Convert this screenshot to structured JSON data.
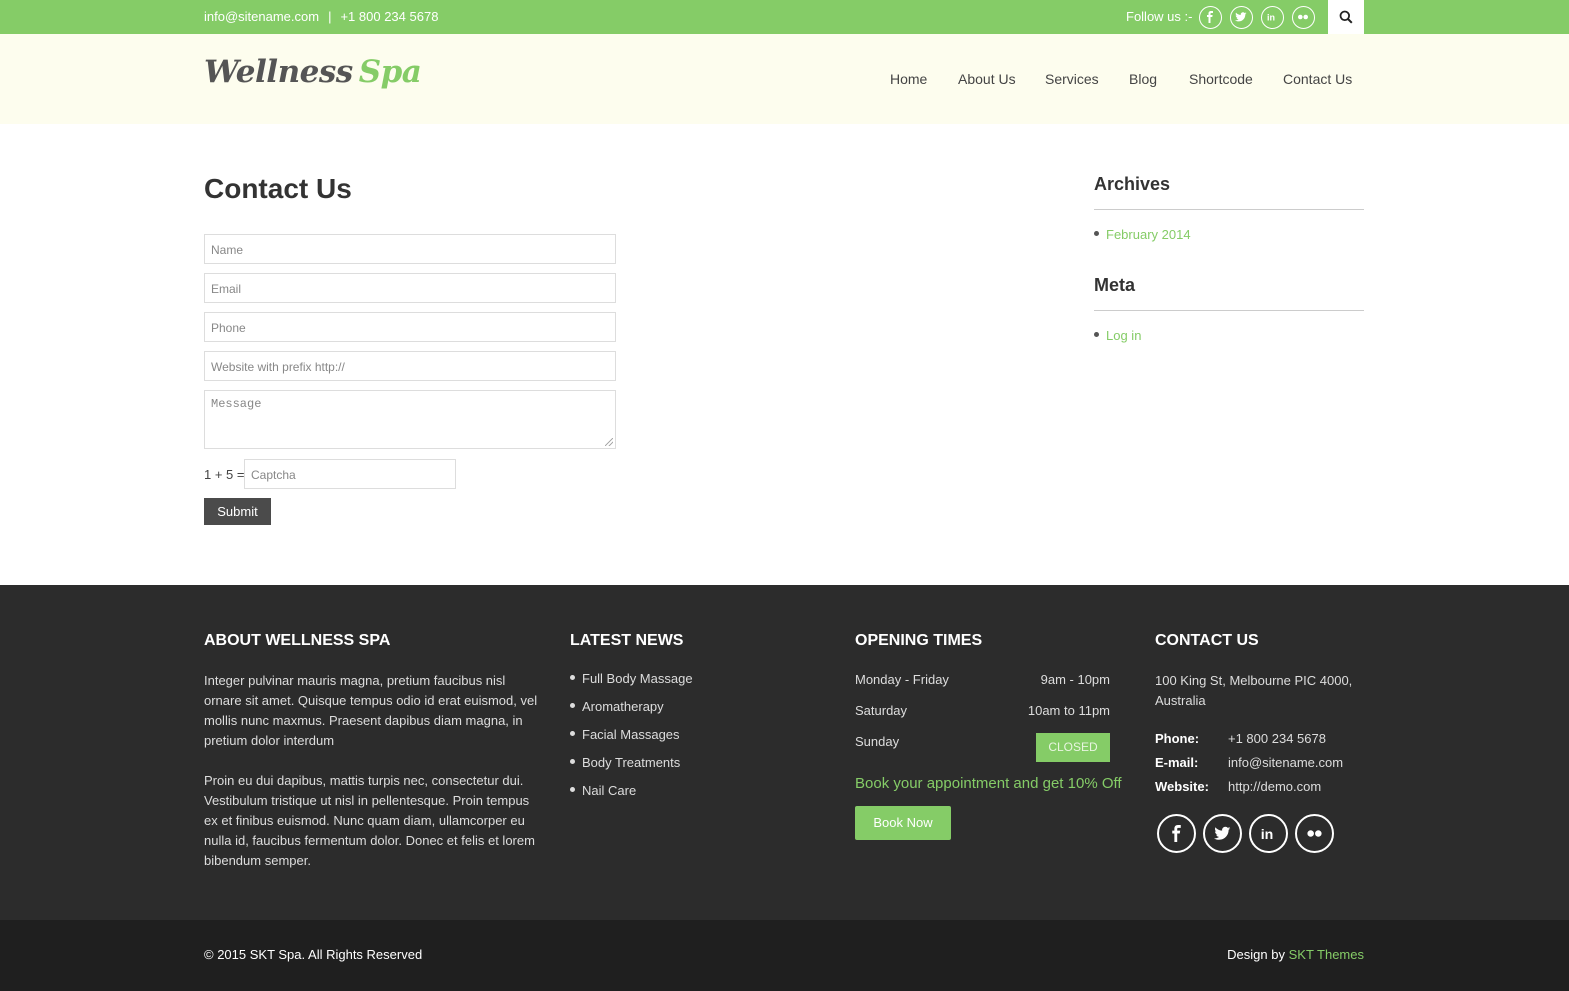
{
  "colors": {
    "accent": "#85cc67",
    "header_bg": "#fdfdee",
    "footer_bg": "#2c2c2c",
    "bottom_bg": "#1f1f1f"
  },
  "topbar": {
    "email": "info@sitename.com",
    "separator": "|",
    "phone": "+1 800 234 5678",
    "follow_label": "Follow us :-",
    "social_icons": [
      "facebook-icon",
      "twitter-icon",
      "linkedin-icon",
      "flickr-icon"
    ],
    "search_icon": "search-icon"
  },
  "header": {
    "logo_word1": "Wellness",
    "logo_word2": "Spa",
    "nav": [
      "Home",
      "About Us",
      "Services",
      "Blog",
      "Shortcode",
      "Contact Us"
    ]
  },
  "main": {
    "title": "Contact Us",
    "form": {
      "name_placeholder": "Name",
      "email_placeholder": "Email",
      "phone_placeholder": "Phone",
      "website_placeholder": "Website with prefix http://",
      "message_placeholder": "Message",
      "captcha_question": "1 + 5 =",
      "captcha_placeholder": "Captcha",
      "submit_label": "Submit"
    }
  },
  "sidebar": {
    "archives_title": "Archives",
    "archives": [
      "February 2014"
    ],
    "meta_title": "Meta",
    "meta": [
      "Log in"
    ]
  },
  "footer": {
    "about": {
      "title": "ABOUT WELLNESS SPA",
      "para1": "Integer pulvinar mauris magna, pretium faucibus nisl ornare sit amet. Quisque tempus odio id erat euismod, vel mollis nunc maxmus. Praesent dapibus diam magna, in pretium dolor interdum",
      "para2": "Proin eu dui dapibus, mattis turpis nec, consectetur dui. Vestibulum tristique ut nisl in pellentesque. Proin tempus ex et finibus euismod. Nunc quam diam, ullamcorper eu nulla id, faucibus fermentum dolor. Donec et felis et lorem bibendum semper."
    },
    "news": {
      "title": "LATEST NEWS",
      "items": [
        "Full Body Massage",
        "Aromatherapy",
        "Facial Massages",
        "Body Treatments",
        "Nail Care"
      ]
    },
    "opening": {
      "title": "OPENING TIMES",
      "rows": [
        {
          "day": "Monday - Friday",
          "hours": "9am - 10pm"
        },
        {
          "day": "Saturday",
          "hours": "10am to 11pm"
        },
        {
          "day": "Sunday",
          "hours": "CLOSED"
        }
      ],
      "promo": "Book your appointment and get 10% Off",
      "book_label": "Book Now"
    },
    "contact": {
      "title": "CONTACT US",
      "address_line1": "100 King St, Melbourne PIC 4000,",
      "address_line2": "Australia",
      "phone_label": "Phone:",
      "phone": "+1 800 234 5678",
      "email_label": "E-mail:",
      "email": "info@sitename.com",
      "website_label": "Website:",
      "website": "http://demo.com",
      "social_icons": [
        "facebook-icon",
        "twitter-icon",
        "linkedin-icon",
        "flickr-icon"
      ]
    }
  },
  "bottom": {
    "copyright": "© 2015 SKT Spa. All Rights Reserved",
    "design_prefix": "Design by",
    "design_link": "SKT Themes"
  }
}
